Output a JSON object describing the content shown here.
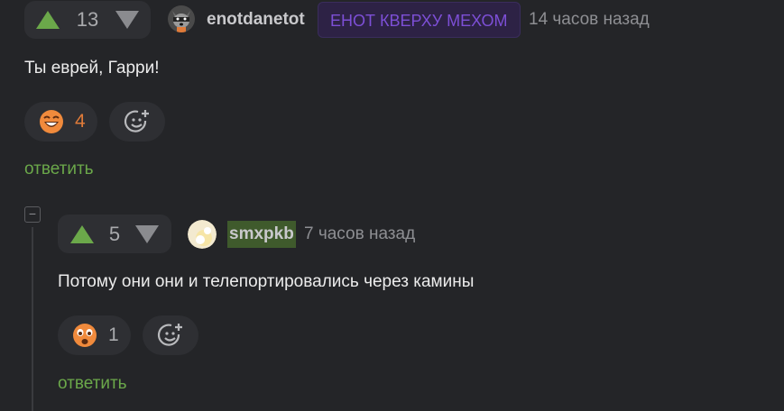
{
  "comment1": {
    "score": "13",
    "username": "enotdanetot",
    "badge": "ЕНОТ КВЕРХУ МЕХОМ",
    "time": "14 часов назад",
    "text": "Ты еврей, Гарри!",
    "reaction_count": "4",
    "reply_label": "ответить"
  },
  "comment2": {
    "score": "5",
    "username": "smxpkb",
    "time": "7 часов назад",
    "text": "Потому они они и телепортировались через камины",
    "reaction_count": "1",
    "reply_label": "ответить",
    "collapse_symbol": "−"
  },
  "colors": {
    "accent_green": "#6ba84a",
    "badge_text": "#7d4fd6",
    "badge_bg": "#2d2245",
    "reaction_count": "#e07b39",
    "username_highlight_bg": "#3f5a2c"
  }
}
